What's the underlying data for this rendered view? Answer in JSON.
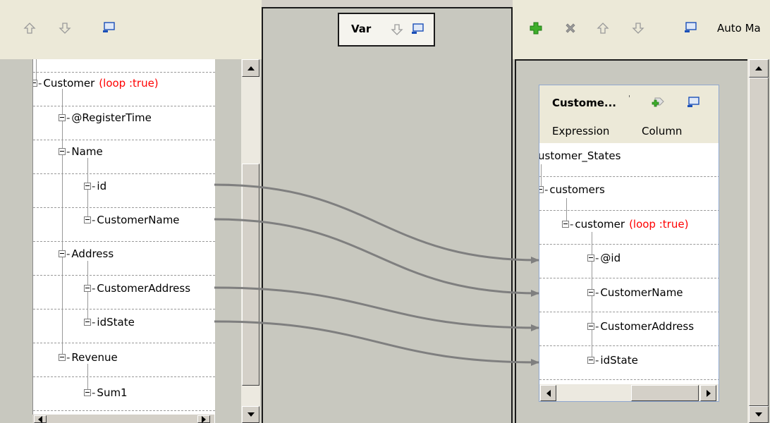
{
  "left_panel": {
    "tree": [
      {
        "label": "Customer",
        "loop": "(loop :true)"
      },
      {
        "label": "@RegisterTime"
      },
      {
        "label": "Name"
      },
      {
        "label": "id"
      },
      {
        "label": "CustomerName"
      },
      {
        "label": "Address"
      },
      {
        "label": "CustomerAddress"
      },
      {
        "label": "idState"
      },
      {
        "label": "Revenue"
      },
      {
        "label": "Sum1"
      }
    ]
  },
  "var_panel": {
    "title": "Var"
  },
  "right_toolbar": {
    "auto_map_label": "Auto Ma"
  },
  "output_table": {
    "title": "Custome...",
    "title_mark": "'",
    "columns": [
      "Expression",
      "Column"
    ],
    "tree": [
      {
        "label": "ustomer_States"
      },
      {
        "label": "customers"
      },
      {
        "label": "customer",
        "loop": "(loop :true)"
      },
      {
        "label": "@id"
      },
      {
        "label": "CustomerName"
      },
      {
        "label": "CustomerAddress"
      },
      {
        "label": "idState"
      }
    ]
  },
  "mappings": [
    {
      "from": "id",
      "to": "@id"
    },
    {
      "from": "CustomerName",
      "to": "CustomerName"
    },
    {
      "from": "CustomerAddress",
      "to": "CustomerAddress"
    },
    {
      "from": "idState",
      "to": "idState"
    }
  ],
  "colors": {
    "loop_text": "#ff0000",
    "link_line": "#7f7f7f",
    "panel_bg": "#c8c8bf",
    "toolbar_bg": "#ece9d8"
  }
}
